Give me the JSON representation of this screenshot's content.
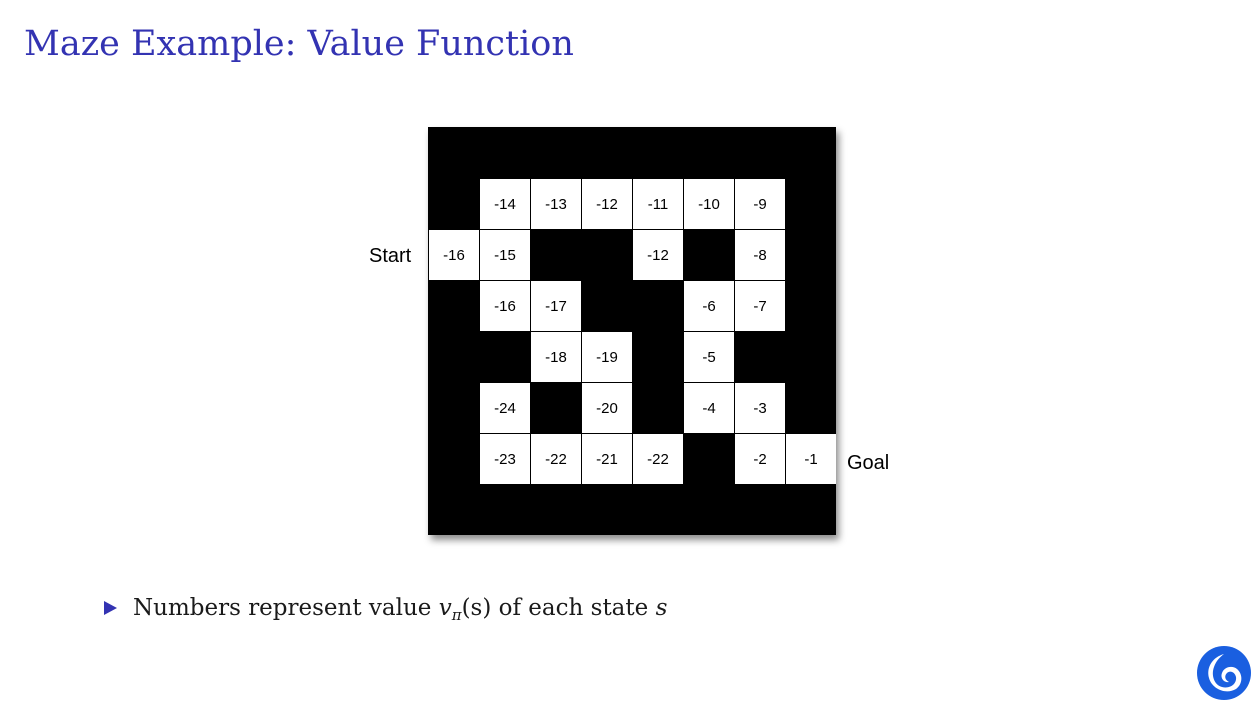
{
  "title": "Maze Example: Value Function",
  "maze": {
    "start_label": "Start",
    "goal_label": "Goal",
    "cells": [
      {
        "row": 0,
        "col": 0,
        "value": "-14"
      },
      {
        "row": 0,
        "col": 1,
        "value": "-13"
      },
      {
        "row": 0,
        "col": 2,
        "value": "-12"
      },
      {
        "row": 0,
        "col": 3,
        "value": "-11"
      },
      {
        "row": 0,
        "col": 4,
        "value": "-10"
      },
      {
        "row": 0,
        "col": 5,
        "value": "-9"
      },
      {
        "row": 1,
        "col": -1,
        "value": "-16"
      },
      {
        "row": 1,
        "col": 0,
        "value": "-15"
      },
      {
        "row": 1,
        "col": 3,
        "value": "-12"
      },
      {
        "row": 1,
        "col": 5,
        "value": "-8"
      },
      {
        "row": 2,
        "col": 0,
        "value": "-16"
      },
      {
        "row": 2,
        "col": 1,
        "value": "-17"
      },
      {
        "row": 2,
        "col": 4,
        "value": "-6"
      },
      {
        "row": 2,
        "col": 5,
        "value": "-7"
      },
      {
        "row": 3,
        "col": 1,
        "value": "-18"
      },
      {
        "row": 3,
        "col": 2,
        "value": "-19"
      },
      {
        "row": 3,
        "col": 4,
        "value": "-5"
      },
      {
        "row": 4,
        "col": 0,
        "value": "-24"
      },
      {
        "row": 4,
        "col": 2,
        "value": "-20"
      },
      {
        "row": 4,
        "col": 4,
        "value": "-4"
      },
      {
        "row": 4,
        "col": 5,
        "value": "-3"
      },
      {
        "row": 5,
        "col": 0,
        "value": "-23"
      },
      {
        "row": 5,
        "col": 1,
        "value": "-22"
      },
      {
        "row": 5,
        "col": 2,
        "value": "-21"
      },
      {
        "row": 5,
        "col": 3,
        "value": "-22"
      },
      {
        "row": 5,
        "col": 5,
        "value": "-2"
      },
      {
        "row": 5,
        "col": 6,
        "value": "-1"
      }
    ]
  },
  "bullet": {
    "text_before": "Numbers represent value ",
    "math_v": "v",
    "math_pi": "π",
    "math_args": "(s)",
    "text_middle": " of each state ",
    "math_s": "s"
  },
  "colors": {
    "title": "#3333b2",
    "bullet_marker": "#3333b2",
    "logo": "#1a5fe0"
  },
  "icons": {
    "bullet": "triangle-right-icon",
    "logo": "deepmind-logo-icon"
  }
}
